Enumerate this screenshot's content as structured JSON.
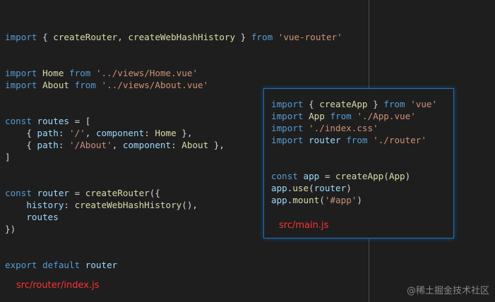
{
  "router_file": {
    "label": "src/router/index.js",
    "lines": [
      [
        {
          "t": "import",
          "c": "kw"
        },
        {
          "t": " { ",
          "c": "plain"
        },
        {
          "t": "createRouter",
          "c": "fn"
        },
        {
          "t": ", ",
          "c": "plain"
        },
        {
          "t": "createWebHashHistory",
          "c": "fn"
        },
        {
          "t": " } ",
          "c": "plain"
        },
        {
          "t": "from",
          "c": "kw"
        },
        {
          "t": " ",
          "c": "plain"
        },
        {
          "t": "'vue-router'",
          "c": "str"
        }
      ],
      [],
      [],
      [
        {
          "t": "import",
          "c": "kw"
        },
        {
          "t": " ",
          "c": "plain"
        },
        {
          "t": "Home",
          "c": "fn"
        },
        {
          "t": " ",
          "c": "plain"
        },
        {
          "t": "from",
          "c": "kw"
        },
        {
          "t": " ",
          "c": "plain"
        },
        {
          "t": "'../views/Home.vue'",
          "c": "str"
        }
      ],
      [
        {
          "t": "import",
          "c": "kw"
        },
        {
          "t": " ",
          "c": "plain"
        },
        {
          "t": "About",
          "c": "fn"
        },
        {
          "t": " ",
          "c": "plain"
        },
        {
          "t": "from",
          "c": "kw"
        },
        {
          "t": " ",
          "c": "plain"
        },
        {
          "t": "'../views/About.vue'",
          "c": "str"
        }
      ],
      [],
      [],
      [
        {
          "t": "const",
          "c": "kw"
        },
        {
          "t": " ",
          "c": "plain"
        },
        {
          "t": "routes",
          "c": "var"
        },
        {
          "t": " = [",
          "c": "plain"
        }
      ],
      [
        {
          "t": "    { ",
          "c": "plain"
        },
        {
          "t": "path",
          "c": "var"
        },
        {
          "t": ": ",
          "c": "plain"
        },
        {
          "t": "'/'",
          "c": "str"
        },
        {
          "t": ", ",
          "c": "plain"
        },
        {
          "t": "component",
          "c": "var"
        },
        {
          "t": ": ",
          "c": "plain"
        },
        {
          "t": "Home",
          "c": "fn"
        },
        {
          "t": " },",
          "c": "plain"
        }
      ],
      [
        {
          "t": "    { ",
          "c": "plain"
        },
        {
          "t": "path",
          "c": "var"
        },
        {
          "t": ": ",
          "c": "plain"
        },
        {
          "t": "'/About'",
          "c": "str"
        },
        {
          "t": ", ",
          "c": "plain"
        },
        {
          "t": "component",
          "c": "var"
        },
        {
          "t": ": ",
          "c": "plain"
        },
        {
          "t": "About",
          "c": "fn"
        },
        {
          "t": " },",
          "c": "plain"
        }
      ],
      [
        {
          "t": "]",
          "c": "plain"
        }
      ],
      [],
      [],
      [
        {
          "t": "const",
          "c": "kw"
        },
        {
          "t": " ",
          "c": "plain"
        },
        {
          "t": "router",
          "c": "var"
        },
        {
          "t": " = ",
          "c": "plain"
        },
        {
          "t": "createRouter",
          "c": "fn"
        },
        {
          "t": "({",
          "c": "plain"
        }
      ],
      [
        {
          "t": "    ",
          "c": "plain"
        },
        {
          "t": "history",
          "c": "var"
        },
        {
          "t": ": ",
          "c": "plain"
        },
        {
          "t": "createWebHashHistory",
          "c": "fn"
        },
        {
          "t": "(),",
          "c": "plain"
        }
      ],
      [
        {
          "t": "    ",
          "c": "plain"
        },
        {
          "t": "routes",
          "c": "var"
        }
      ],
      [
        {
          "t": "})",
          "c": "plain"
        }
      ],
      [],
      [],
      [
        {
          "t": "export",
          "c": "kw"
        },
        {
          "t": " ",
          "c": "plain"
        },
        {
          "t": "default",
          "c": "kw"
        },
        {
          "t": " ",
          "c": "plain"
        },
        {
          "t": "router",
          "c": "var"
        }
      ]
    ]
  },
  "main_file": {
    "label": "src/main.js",
    "lines": [
      [
        {
          "t": "import",
          "c": "kw"
        },
        {
          "t": " { ",
          "c": "plain"
        },
        {
          "t": "createApp",
          "c": "fn"
        },
        {
          "t": " } ",
          "c": "plain"
        },
        {
          "t": "from",
          "c": "kw"
        },
        {
          "t": " ",
          "c": "plain"
        },
        {
          "t": "'vue'",
          "c": "str"
        }
      ],
      [
        {
          "t": "import",
          "c": "kw"
        },
        {
          "t": " ",
          "c": "plain"
        },
        {
          "t": "App",
          "c": "fn"
        },
        {
          "t": " ",
          "c": "plain"
        },
        {
          "t": "from",
          "c": "kw"
        },
        {
          "t": " ",
          "c": "plain"
        },
        {
          "t": "'./App.vue'",
          "c": "str"
        }
      ],
      [
        {
          "t": "import",
          "c": "kw"
        },
        {
          "t": " ",
          "c": "plain"
        },
        {
          "t": "'./index.css'",
          "c": "str"
        }
      ],
      [
        {
          "t": "import",
          "c": "kw"
        },
        {
          "t": " ",
          "c": "plain"
        },
        {
          "t": "router",
          "c": "var"
        },
        {
          "t": " ",
          "c": "plain"
        },
        {
          "t": "from",
          "c": "kw"
        },
        {
          "t": " ",
          "c": "plain"
        },
        {
          "t": "'./router'",
          "c": "str"
        }
      ],
      [],
      [],
      [
        {
          "t": "const",
          "c": "kw"
        },
        {
          "t": " ",
          "c": "plain"
        },
        {
          "t": "app",
          "c": "var"
        },
        {
          "t": " = ",
          "c": "plain"
        },
        {
          "t": "createApp",
          "c": "fn"
        },
        {
          "t": "(",
          "c": "plain"
        },
        {
          "t": "App",
          "c": "fn"
        },
        {
          "t": ")",
          "c": "plain"
        }
      ],
      [
        {
          "t": "app",
          "c": "var"
        },
        {
          "t": ".",
          "c": "plain"
        },
        {
          "t": "use",
          "c": "fn"
        },
        {
          "t": "(",
          "c": "plain"
        },
        {
          "t": "router",
          "c": "var"
        },
        {
          "t": ")",
          "c": "plain"
        }
      ],
      [
        {
          "t": "app",
          "c": "var"
        },
        {
          "t": ".",
          "c": "plain"
        },
        {
          "t": "mount",
          "c": "fn"
        },
        {
          "t": "(",
          "c": "plain"
        },
        {
          "t": "'#app'",
          "c": "str"
        },
        {
          "t": ")",
          "c": "plain"
        }
      ]
    ]
  },
  "watermark": "@稀土掘金技术社区"
}
